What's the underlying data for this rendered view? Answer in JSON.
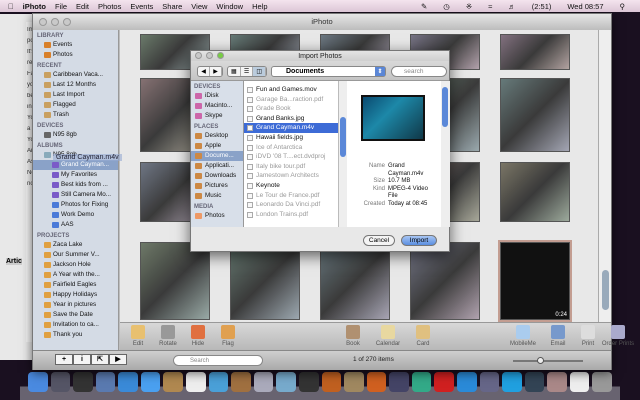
{
  "menubar": {
    "app": "iPhoto",
    "items": [
      "File",
      "Edit",
      "Photos",
      "Events",
      "Share",
      "View",
      "Window",
      "Help"
    ],
    "battery": "(2:51)",
    "clock": "Wed 08:57"
  },
  "window": {
    "title": "iPhoto"
  },
  "sidebar": {
    "library_header": "LIBRARY",
    "library": [
      "Events",
      "Photos"
    ],
    "recent_header": "RECENT",
    "recent": [
      "Caribbean Vaca...",
      "Last 12 Months",
      "Last Import",
      "Flagged",
      "Trash"
    ],
    "devices_header": "DEVICES",
    "devices": [
      "N95 8gb"
    ],
    "albums_header": "ALBUMS",
    "albums_folder": "N95 8gb",
    "albums": [
      "Grand Cayman...",
      "My Favorites",
      "Best kids from ...",
      "Still Camera Mo...",
      "Photos for Fixing",
      "Work Demo",
      "AAS"
    ],
    "projects_header": "PROJECTS",
    "projects": [
      "Zaca Lake",
      "Our Summer V...",
      "Jackson Hole",
      "A Year with the...",
      "Fairfield Eagles",
      "Happy Holidays",
      "Year in pictures",
      "Save the Date",
      "Invitation to ca...",
      "Thank you"
    ],
    "drag_label": "Grand Cayman.m4v"
  },
  "grid": {
    "video_duration": "0:24"
  },
  "toolbar": {
    "left": [
      "Edit",
      "Rotate",
      "Hide",
      "Flag"
    ],
    "middle": [
      "Book",
      "Calendar",
      "Card"
    ],
    "right": [
      "MobileMe",
      "Email",
      "Print",
      "Order Prints"
    ]
  },
  "bottom": {
    "search_placeholder": "Search",
    "count": "1 of 270 items"
  },
  "back_window": {
    "label": "Artic",
    "snippets": [
      "Im",
      "po",
      "It's",
      "rec",
      "Fa",
      "yo",
      "be",
      "in",
      "Yo",
      "a f",
      "Yo",
      "An",
      "As",
      "No",
      "no"
    ]
  },
  "dialog": {
    "title": "Import Photos",
    "location": "Documents",
    "search_placeholder": "search",
    "devices_header": "DEVICES",
    "devices": [
      "iDisk",
      "Macinto...",
      "Skype"
    ],
    "places_header": "PLACES",
    "places": [
      "Desktop",
      "Apple",
      "Docume...",
      "Applicati...",
      "Downloads",
      "Pictures",
      "Music"
    ],
    "media_header": "MEDIA",
    "media": [
      "Photos"
    ],
    "files": [
      {
        "name": "Fun and Games.mov",
        "enabled": true
      },
      {
        "name": "Garage Ba...raction.pdf",
        "enabled": false
      },
      {
        "name": "Grade Book",
        "enabled": false
      },
      {
        "name": "Grand Banks.jpg",
        "enabled": true
      },
      {
        "name": "Grand Cayman.m4v",
        "enabled": true,
        "selected": true
      },
      {
        "name": "Hawaii fields.jpg",
        "enabled": true
      },
      {
        "name": "Ice of Antarctica",
        "enabled": false
      },
      {
        "name": "iDVD '08 T....ect.dvdproj",
        "enabled": false
      },
      {
        "name": "Italy bike tour.pdf",
        "enabled": false
      },
      {
        "name": "Jamestown Architects",
        "enabled": false
      },
      {
        "name": "Keynote",
        "enabled": true
      },
      {
        "name": "Le Tour de France.pdf",
        "enabled": false
      },
      {
        "name": "Leonardo Da Vinci.pdf",
        "enabled": false
      },
      {
        "name": "London Trains.pdf",
        "enabled": false
      }
    ],
    "info": {
      "name_label": "Name",
      "name": "Grand Cayman.m4v",
      "size_label": "Size",
      "size": "10.7 MB",
      "kind_label": "Kind",
      "kind": "MPEG-4 Video File",
      "created_label": "Created",
      "created": "Today at 08:45"
    },
    "cancel": "Cancel",
    "import": "Import"
  },
  "dock": [
    "Finder",
    "Dashboard",
    "Clock",
    "Preview",
    "Safari",
    "iChat",
    "Address Book",
    "iCal",
    "iTunes",
    "iPhoto",
    "Image Capture",
    "Aquarium",
    "iMovie",
    "GarageBand",
    "Pages",
    "Keynote",
    "Script Editor",
    "Numbers",
    "eTextEditor",
    "QuickTime",
    "iPhoto Library",
    "Skype",
    "Downloads",
    "Documents",
    "Text Document",
    "Trash"
  ]
}
